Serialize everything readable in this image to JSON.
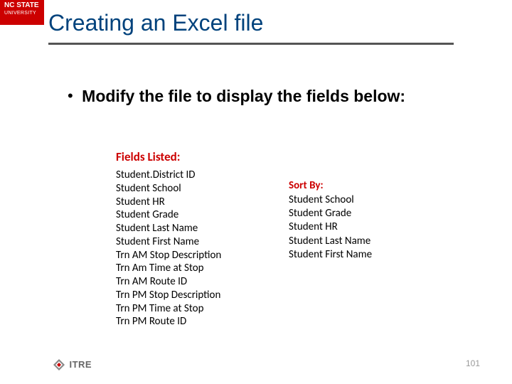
{
  "brand": {
    "line1": "NC STATE",
    "line2": "UNIVERSITY"
  },
  "title": "Creating an Excel file",
  "bullet": "Modify the file to display the fields below:",
  "fields": {
    "heading": "Fields Listed:",
    "items": [
      "Student.District ID",
      "Student School",
      "Student HR",
      "Student Grade",
      "Student Last Name",
      "Student First Name",
      "Trn AM Stop Description",
      "Trn Am Time at Stop",
      "Trn AM Route ID",
      "Trn PM Stop Description",
      "Trn PM Time at Stop",
      "Trn PM Route ID"
    ]
  },
  "sort": {
    "heading": "Sort By:",
    "items": [
      "Student School",
      "Student Grade",
      "Student HR",
      "Student Last Name",
      "Student First Name"
    ]
  },
  "footer": {
    "logo_text": "ITRE"
  },
  "page_number": "101"
}
